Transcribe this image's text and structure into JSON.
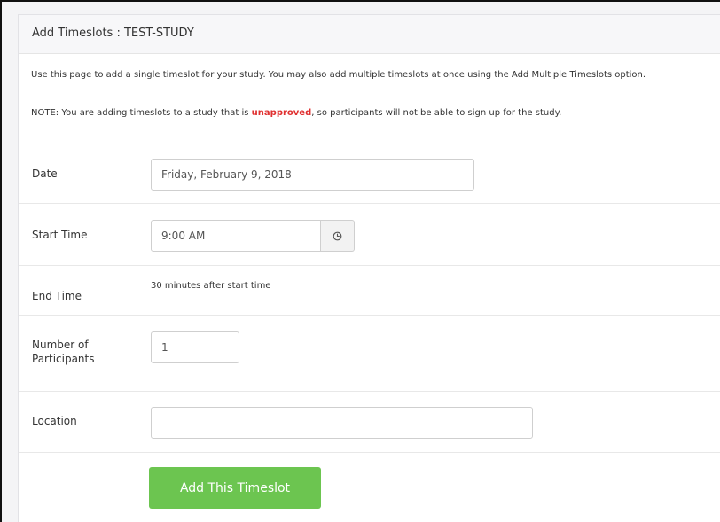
{
  "header": {
    "title": "Add Timeslots : TEST-STUDY"
  },
  "intro": {
    "text": "Use this page to add a single timeslot for your study. You may also add multiple timeslots at once using the Add Multiple Timeslots option."
  },
  "note": {
    "prefix": "NOTE: You are adding timeslots to a study that is ",
    "highlight": "unapproved",
    "suffix": ", so participants will not be able to sign up for the study.",
    "highlight_color": "#e03131"
  },
  "form": {
    "date": {
      "label": "Date",
      "value": "Friday, February 9, 2018"
    },
    "start_time": {
      "label": "Start Time",
      "value": "9:00 AM",
      "icon": "clock-icon"
    },
    "end_time": {
      "label": "End Time",
      "value": "30 minutes after start time"
    },
    "participants": {
      "label_line1": "Number of",
      "label_line2": "Participants",
      "value": "1"
    },
    "location": {
      "label": "Location",
      "value": ""
    },
    "submit": {
      "label": "Add This Timeslot",
      "color": "#6cc550"
    }
  }
}
